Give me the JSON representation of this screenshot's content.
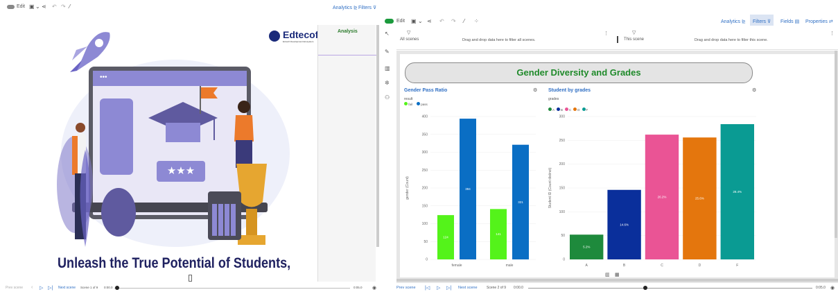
{
  "left_panel": {
    "toolbar": {
      "edit_label": "Edit",
      "analytics_label": "Analytics",
      "filters_label": "Filters"
    },
    "side_panel": {
      "tab_label": "Analysis"
    },
    "slide": {
      "logo_text": "Edtecofy",
      "logo_tagline": "Ed-tech Development Ecosystem",
      "headline": "Unleash the True Potential of Students,"
    },
    "footer": {
      "prev_label": "Prev scene",
      "next_label": "Next scene",
      "scene_counter": "Scene 1 of 9",
      "time_start": "0:00.0",
      "time_end": "0:05.0"
    }
  },
  "right_panel": {
    "toolbar": {
      "edit_label": "Edit",
      "analytics_label": "Analytics",
      "filters_label": "Filters",
      "fields_label": "Fields",
      "properties_label": "Properties"
    },
    "filter_all": {
      "title": "All scenes",
      "drop_hint": "Drag and drop data here to filter all scenes."
    },
    "filter_this": {
      "title": "This scene",
      "drop_hint": "Drag and drop data here to filter this scene."
    },
    "dashboard_title": "Gender Diversity and Grades",
    "footer": {
      "prev_label": "Prev scene",
      "next_label": "Next scene",
      "scene_counter": "Scene 2 of 9",
      "time_start": "0:00.0",
      "time_end": "0:05.0"
    }
  },
  "chart_data": [
    {
      "type": "bar",
      "title": "Gender Pass Ratio",
      "legend_title": "result",
      "categories": [
        "female",
        "male"
      ],
      "series": [
        {
          "name": "fail",
          "color": "#54f31a",
          "values": [
            124,
            141
          ]
        },
        {
          "name": "pass",
          "color": "#0a6ec4",
          "values": [
            394,
            321
          ]
        }
      ],
      "ylabel": "gender (Count)",
      "ylim": [
        0,
        400
      ],
      "yticks": [
        0,
        50,
        100,
        150,
        200,
        250,
        300,
        350,
        400
      ],
      "legend_position": "top-left"
    },
    {
      "type": "bar",
      "title": "Student by grades",
      "legend_title": "grades",
      "categories": [
        "A",
        "B",
        "C",
        "D",
        "F"
      ],
      "values": [
        52,
        146,
        262,
        256,
        284
      ],
      "labels": [
        "5.2%",
        "14.6%",
        "26.2%",
        "25.6%",
        "28.4%"
      ],
      "colors": [
        "#1e8a3c",
        "#0a2f9b",
        "#ea5495",
        "#e4760d",
        "#0a9b93"
      ],
      "ylabel": "Student ID (Count distinct)",
      "ylim": [
        0,
        300
      ],
      "yticks": [
        0,
        50,
        100,
        150,
        200,
        250,
        300
      ],
      "legend_position": "top-left"
    }
  ]
}
